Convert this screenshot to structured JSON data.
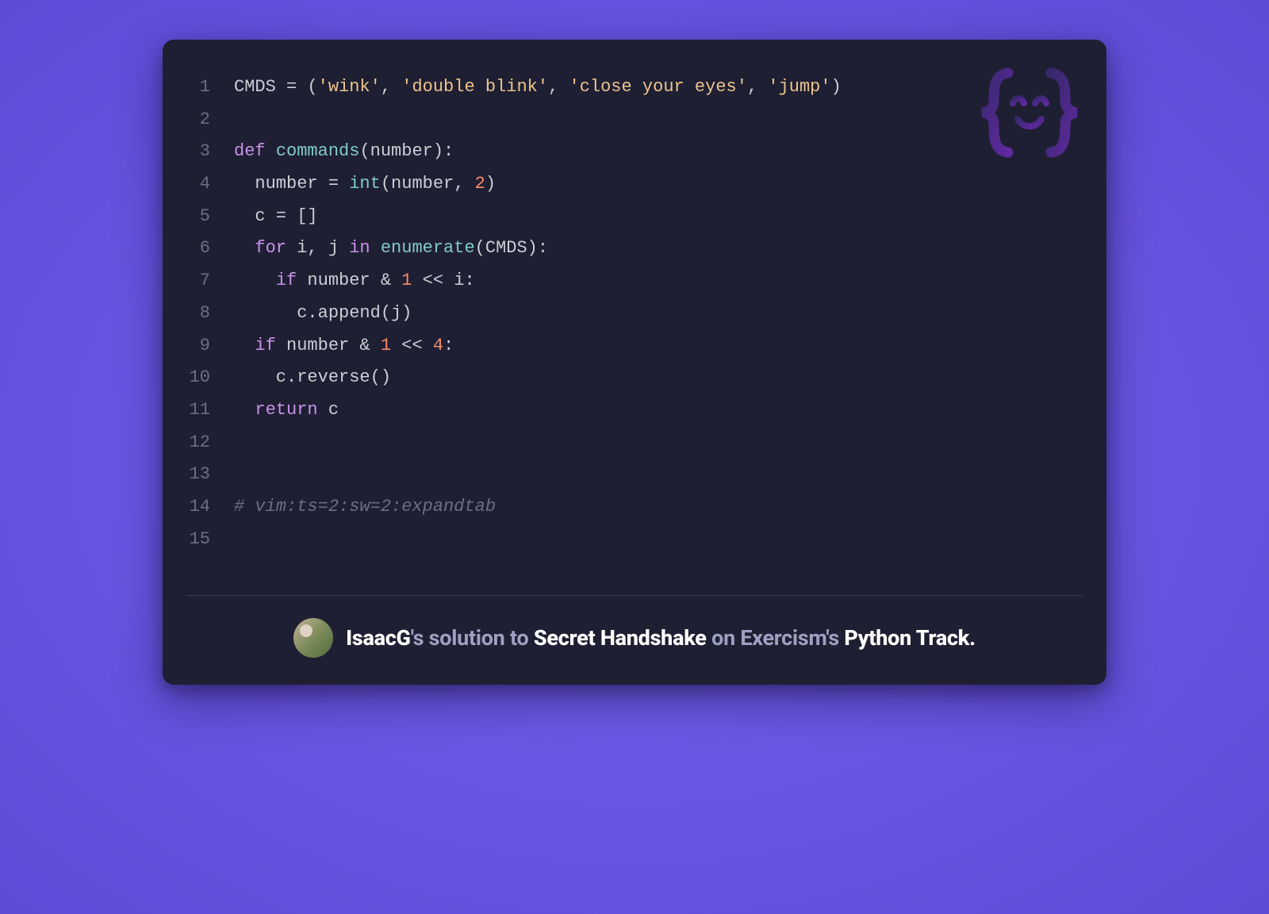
{
  "code": {
    "lines": [
      {
        "n": 1,
        "tokens": [
          {
            "t": "CMDS = (",
            "c": "def"
          },
          {
            "t": "'wink'",
            "c": "str"
          },
          {
            "t": ", ",
            "c": "def"
          },
          {
            "t": "'double blink'",
            "c": "str"
          },
          {
            "t": ", ",
            "c": "def"
          },
          {
            "t": "'close your eyes'",
            "c": "str"
          },
          {
            "t": ", ",
            "c": "def"
          },
          {
            "t": "'jump'",
            "c": "str"
          },
          {
            "t": ")",
            "c": "def"
          }
        ]
      },
      {
        "n": 2,
        "tokens": []
      },
      {
        "n": 3,
        "tokens": [
          {
            "t": "def ",
            "c": "kw"
          },
          {
            "t": "commands",
            "c": "fn"
          },
          {
            "t": "(number):",
            "c": "def"
          }
        ]
      },
      {
        "n": 4,
        "tokens": [
          {
            "t": "  number = ",
            "c": "def"
          },
          {
            "t": "int",
            "c": "fn"
          },
          {
            "t": "(number, ",
            "c": "def"
          },
          {
            "t": "2",
            "c": "num"
          },
          {
            "t": ")",
            "c": "def"
          }
        ]
      },
      {
        "n": 5,
        "tokens": [
          {
            "t": "  c = []",
            "c": "def"
          }
        ]
      },
      {
        "n": 6,
        "tokens": [
          {
            "t": "  ",
            "c": "def"
          },
          {
            "t": "for",
            "c": "kw"
          },
          {
            "t": " i, j ",
            "c": "def"
          },
          {
            "t": "in",
            "c": "kw"
          },
          {
            "t": " ",
            "c": "def"
          },
          {
            "t": "enumerate",
            "c": "fn"
          },
          {
            "t": "(CMDS):",
            "c": "def"
          }
        ]
      },
      {
        "n": 7,
        "tokens": [
          {
            "t": "    ",
            "c": "def"
          },
          {
            "t": "if",
            "c": "kw"
          },
          {
            "t": " number & ",
            "c": "def"
          },
          {
            "t": "1",
            "c": "num"
          },
          {
            "t": " << i:",
            "c": "def"
          }
        ]
      },
      {
        "n": 8,
        "tokens": [
          {
            "t": "      c.append(j)",
            "c": "def"
          }
        ]
      },
      {
        "n": 9,
        "tokens": [
          {
            "t": "  ",
            "c": "def"
          },
          {
            "t": "if",
            "c": "kw"
          },
          {
            "t": " number & ",
            "c": "def"
          },
          {
            "t": "1",
            "c": "num"
          },
          {
            "t": " << ",
            "c": "def"
          },
          {
            "t": "4",
            "c": "num"
          },
          {
            "t": ":",
            "c": "def"
          }
        ]
      },
      {
        "n": 10,
        "tokens": [
          {
            "t": "    c.reverse()",
            "c": "def"
          }
        ]
      },
      {
        "n": 11,
        "tokens": [
          {
            "t": "  ",
            "c": "def"
          },
          {
            "t": "return",
            "c": "kw"
          },
          {
            "t": " c",
            "c": "def"
          }
        ]
      },
      {
        "n": 12,
        "tokens": []
      },
      {
        "n": 13,
        "tokens": []
      },
      {
        "n": 14,
        "tokens": [
          {
            "t": "# vim:ts=2:sw=2:expandtab",
            "c": "cmt"
          }
        ]
      },
      {
        "n": 15,
        "tokens": []
      }
    ]
  },
  "attribution": {
    "author": "IsaacG",
    "possessive": "'s ",
    "solution_to": "solution to ",
    "exercise": "Secret Handshake",
    "on": " on Exercism's ",
    "track": "Python Track."
  },
  "watermark_icon": "exercism-logo-icon"
}
